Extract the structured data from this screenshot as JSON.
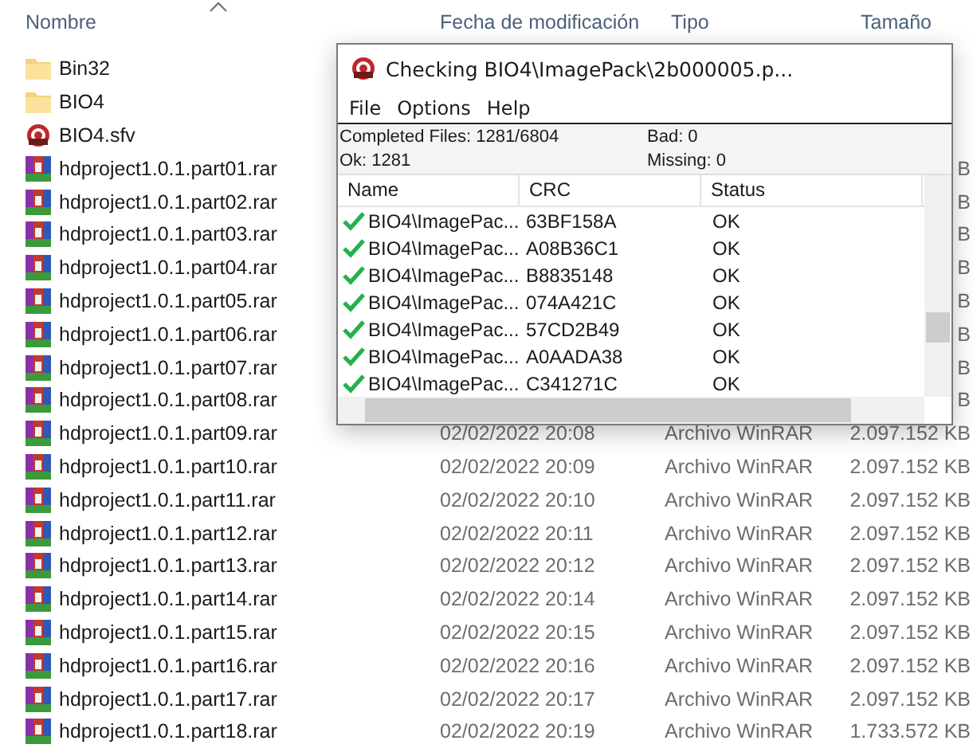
{
  "explorer": {
    "columns": [
      "Nombre",
      "Fecha de modificación",
      "Tipo",
      "Tamaño"
    ],
    "rows": [
      {
        "kind": "folder",
        "name": "Bin32"
      },
      {
        "kind": "folder",
        "name": "BIO4"
      },
      {
        "kind": "sfv",
        "name": "BIO4.sfv"
      },
      {
        "kind": "rar",
        "name": "hdproject1.0.1.part01.rar",
        "size": "B"
      },
      {
        "kind": "rar",
        "name": "hdproject1.0.1.part02.rar",
        "size": "B"
      },
      {
        "kind": "rar",
        "name": "hdproject1.0.1.part03.rar",
        "size": "B"
      },
      {
        "kind": "rar",
        "name": "hdproject1.0.1.part04.rar",
        "size": "B"
      },
      {
        "kind": "rar",
        "name": "hdproject1.0.1.part05.rar",
        "size": "B"
      },
      {
        "kind": "rar",
        "name": "hdproject1.0.1.part06.rar",
        "size": "B"
      },
      {
        "kind": "rar",
        "name": "hdproject1.0.1.part07.rar",
        "size": "B"
      },
      {
        "kind": "rar",
        "name": "hdproject1.0.1.part08.rar",
        "size": "B"
      },
      {
        "kind": "rar",
        "name": "hdproject1.0.1.part09.rar",
        "date": "02/02/2022 20:08",
        "type": "Archivo WinRAR",
        "size": "2.097.152 KB"
      },
      {
        "kind": "rar",
        "name": "hdproject1.0.1.part10.rar",
        "date": "02/02/2022 20:09",
        "type": "Archivo WinRAR",
        "size": "2.097.152 KB"
      },
      {
        "kind": "rar",
        "name": "hdproject1.0.1.part11.rar",
        "date": "02/02/2022 20:10",
        "type": "Archivo WinRAR",
        "size": "2.097.152 KB"
      },
      {
        "kind": "rar",
        "name": "hdproject1.0.1.part12.rar",
        "date": "02/02/2022 20:11",
        "type": "Archivo WinRAR",
        "size": "2.097.152 KB"
      },
      {
        "kind": "rar",
        "name": "hdproject1.0.1.part13.rar",
        "date": "02/02/2022 20:12",
        "type": "Archivo WinRAR",
        "size": "2.097.152 KB"
      },
      {
        "kind": "rar",
        "name": "hdproject1.0.1.part14.rar",
        "date": "02/02/2022 20:14",
        "type": "Archivo WinRAR",
        "size": "2.097.152 KB"
      },
      {
        "kind": "rar",
        "name": "hdproject1.0.1.part15.rar",
        "date": "02/02/2022 20:15",
        "type": "Archivo WinRAR",
        "size": "2.097.152 KB"
      },
      {
        "kind": "rar",
        "name": "hdproject1.0.1.part16.rar",
        "date": "02/02/2022 20:16",
        "type": "Archivo WinRAR",
        "size": "2.097.152 KB"
      },
      {
        "kind": "rar",
        "name": "hdproject1.0.1.part17.rar",
        "date": "02/02/2022 20:17",
        "type": "Archivo WinRAR",
        "size": "2.097.152 KB"
      },
      {
        "kind": "rar",
        "name": "hdproject1.0.1.part18.rar",
        "date": "02/02/2022 20:19",
        "type": "Archivo WinRAR",
        "size": "1.733.572 KB"
      }
    ]
  },
  "dialog": {
    "title": "Checking BIO4\\ImagePack\\2b000005.p...",
    "menu": [
      "File",
      "Options",
      "Help"
    ],
    "stats": [
      "Completed Files: 1281/6804",
      "Bad: 0",
      "Ok: 1281",
      "Missing: 0"
    ],
    "columns": [
      "Name",
      "CRC",
      "Status"
    ],
    "rows": [
      {
        "name": "BIO4\\ImagePac...",
        "crc": "63BF158A",
        "status": "OK"
      },
      {
        "name": "BIO4\\ImagePac...",
        "crc": "A08B36C1",
        "status": "OK"
      },
      {
        "name": "BIO4\\ImagePac...",
        "crc": "B8835148",
        "status": "OK"
      },
      {
        "name": "BIO4\\ImagePac...",
        "crc": "074A421C",
        "status": "OK"
      },
      {
        "name": "BIO4\\ImagePac...",
        "crc": "57CD2B49",
        "status": "OK"
      },
      {
        "name": "BIO4\\ImagePac...",
        "crc": "A0AADA38",
        "status": "OK"
      },
      {
        "name": "BIO4\\ImagePac...",
        "crc": "C341271C",
        "status": "OK"
      }
    ]
  }
}
